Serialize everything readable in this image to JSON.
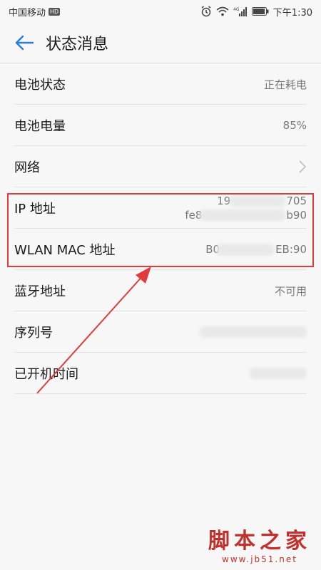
{
  "status_bar": {
    "carrier": "中国移动",
    "hd_badge": "HD",
    "network_indicator": "4G",
    "time": "下午1:30"
  },
  "header": {
    "title": "状态消息"
  },
  "rows": [
    {
      "label": "电池状态",
      "value": "正在耗电"
    },
    {
      "label": "电池电量",
      "value": "85%"
    },
    {
      "label": "网络",
      "value": ""
    },
    {
      "label": "IP 地址",
      "value_line1": "19",
      "value_line1_end": "705",
      "value_line2": "fe8",
      "value_line2_end": "b90"
    },
    {
      "label": "WLAN MAC 地址",
      "value": "B0",
      "value_end": "EB:90"
    },
    {
      "label": "蓝牙地址",
      "value": "不可用"
    },
    {
      "label": "序列号",
      "value": ""
    },
    {
      "label": "已开机时间",
      "value": ""
    }
  ],
  "watermark": {
    "main": "脚本之家",
    "sub": "www.jb51.net"
  },
  "colors": {
    "accent": "#2b7de1",
    "highlight": "#e23b3b"
  }
}
